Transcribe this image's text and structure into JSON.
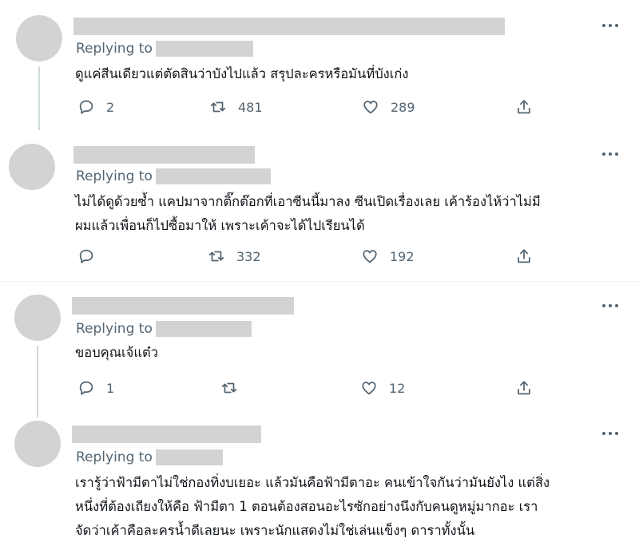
{
  "reply_prefix": "Replying to",
  "tweets": [
    {
      "text_lines": [
        "ดูแค่สีนเดียวแต่ตัดสินว่าบังไปแล้ว สรุปละครหรือมันที่บังเก่ง"
      ],
      "reply_count": "2",
      "retweet_count": "481",
      "like_count": "289"
    },
    {
      "text_lines": [
        "ไม่ได้ดูด้วยซ้ำ แคปมาจากติ๊กต๊อกที่เอาซีนนี้มาลง ซีนเปิดเรื่องเลย เค้าร้องไห้ว่าไม่มี",
        "ผมแล้วเพื่อนก็ไปซื้อมาให้ เพราะเค้าจะได้ไปเรียนได้"
      ],
      "reply_count": "",
      "retweet_count": "332",
      "like_count": "192"
    },
    {
      "text_lines": [
        "ขอบคุณเจ้แต๋ว"
      ],
      "reply_count": "1",
      "retweet_count": "",
      "like_count": "12"
    },
    {
      "text_lines": [
        "เรารู้ว่าฟ้ามีตาไม่ใช่กองทิ่งบเยอะ แล้วมันคือฟ้ามีตาอะ คนเข้าใจกันว่ามันยังไง แต่สิ่ง",
        "หนึ่งที่ต้องเถียงให้คือ ฟ้ามีตา 1 ตอนต้องสอนอะไรซักอย่างนึงกับคนดูหมู่มากอะ เรา",
        "จัดว่าเค้าคือละครน้ำดีเลยนะ เพราะนักแสดงไม่ใช่เล่นแข็งๆ ดาราทั้งนั้น"
      ]
    }
  ],
  "icons": {
    "reply": "reply-icon",
    "retweet": "retweet-icon",
    "like": "heart-icon",
    "share": "share-icon",
    "more": "more-icon"
  },
  "colors": {
    "muted": "#536471",
    "redacted": "#d3d3d3",
    "text": "#0f1419",
    "divider": "#eff3f4"
  }
}
